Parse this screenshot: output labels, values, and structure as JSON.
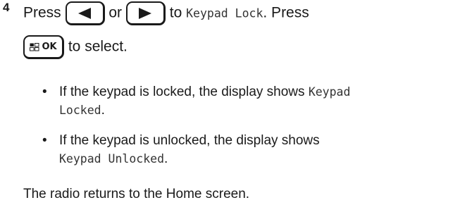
{
  "step": {
    "number": "4",
    "instruction": {
      "press_1": "Press",
      "or": "or",
      "to_1": "to",
      "menu_item": "Keypad Lock",
      "period_press": ". Press",
      "to_select": "to select."
    },
    "keys": {
      "left_arrow_icon": "left-triangle-arrow",
      "right_arrow_icon": "right-triangle-arrow",
      "ok_button_label": "OK",
      "ok_button_icon": "menu-grid"
    },
    "bullets": [
      {
        "text_before": "If the keypad is locked, the display shows",
        "display_text_line1": "Keypad",
        "display_text_line2": "Locked",
        "suffix": "."
      },
      {
        "text_before": "If the keypad is unlocked, the display shows",
        "display_text": "Keypad Unlocked",
        "suffix": "."
      }
    ],
    "result": "The radio returns to the Home screen."
  }
}
